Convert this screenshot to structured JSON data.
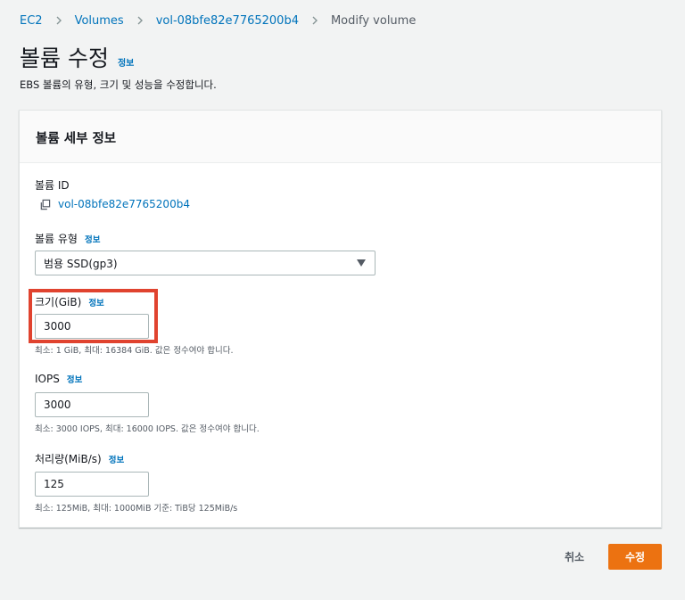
{
  "breadcrumb": {
    "items": [
      "EC2",
      "Volumes",
      "vol-08bfe82e7765200b4"
    ],
    "current": "Modify volume"
  },
  "header": {
    "title": "볼륨 수정",
    "info_label": "정보",
    "description": "EBS 볼륨의 유형, 크기 및 성능을 수정합니다."
  },
  "panel": {
    "title": "볼륨 세부 정보",
    "volume_id": {
      "label": "볼륨 ID",
      "value": "vol-08bfe82e7765200b4"
    },
    "volume_type": {
      "label": "볼륨 유형",
      "info_label": "정보",
      "selected": "범용 SSD(gp3)"
    },
    "size": {
      "label": "크기(GiB)",
      "info_label": "정보",
      "value": "3000",
      "constraint": "최소: 1 GiB, 최대: 16384 GiB. 값은 정수여야 합니다."
    },
    "iops": {
      "label": "IOPS",
      "info_label": "정보",
      "value": "3000",
      "constraint": "최소: 3000 IOPS, 최대: 16000 IOPS. 값은 정수여야 합니다."
    },
    "throughput": {
      "label": "처리량(MiB/s)",
      "info_label": "정보",
      "value": "125",
      "constraint": "최소: 125MiB, 최대: 1000MiB 기준: TiB당 125MiB/s"
    }
  },
  "footer": {
    "cancel_label": "취소",
    "submit_label": "수정"
  },
  "colors": {
    "link": "#0073bb",
    "primary_button": "#ec7211",
    "highlight": "#e0432f",
    "background": "#f2f3f3"
  },
  "icons": {
    "breadcrumb_separator": "chevron-right-icon",
    "copy": "copy-icon",
    "select_arrow": "caret-down-icon"
  }
}
